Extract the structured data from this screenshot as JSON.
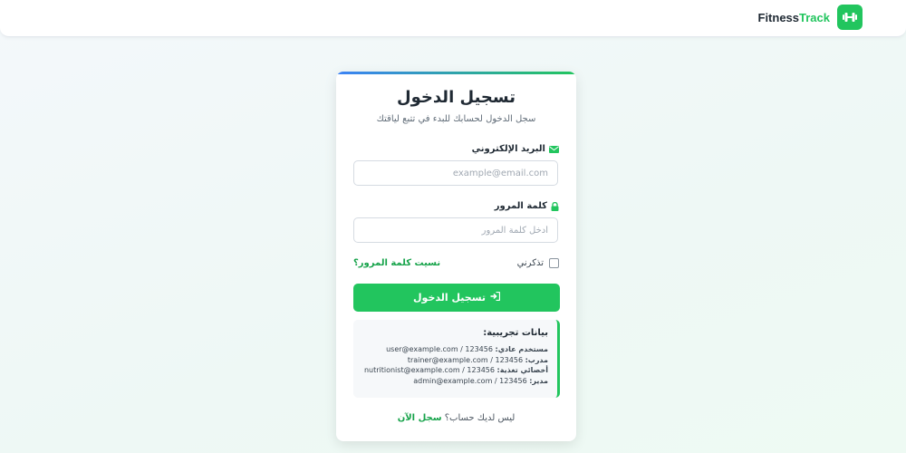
{
  "brand": {
    "name_part1": "Fitness",
    "name_part2": "Track",
    "logo_icon": "dumbbell-icon"
  },
  "login": {
    "title": "تسجيل الدخول",
    "subtitle": "سجل الدخول لحسابك للبدء في تتبع لياقتك",
    "email_label": "البريد الإلكتروني",
    "email_placeholder": "example@email.com",
    "email_value": "",
    "password_label": "كلمة المرور",
    "password_placeholder": "أدخل كلمة المرور",
    "password_value": "",
    "remember_label": "تذكرني",
    "remember_checked": false,
    "forgot_link": "نسيت كلمة المرور؟",
    "submit_label": "تسجيل الدخول"
  },
  "demo": {
    "title": "بيانات تجريبية:",
    "accounts": [
      {
        "role": "مستخدم عادي:",
        "creds": "user@example.com / 123456"
      },
      {
        "role": "مدرب:",
        "creds": "trainer@example.com / 123456"
      },
      {
        "role": "أخصائي تغذية:",
        "creds": "nutritionist@example.com / 123456"
      },
      {
        "role": "مدير:",
        "creds": "admin@example.com / 123456"
      }
    ]
  },
  "signup": {
    "prompt": "ليس لديك حساب؟",
    "link": "سجل الآن"
  },
  "colors": {
    "accent": "#22c55e",
    "accent_dark": "#16a34a",
    "top_gradient_start": "#3b82f6"
  }
}
